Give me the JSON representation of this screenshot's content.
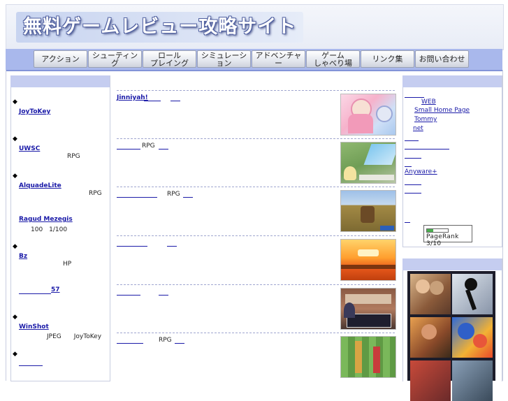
{
  "header": {
    "title": "無料ゲームレビュー攻略サイト"
  },
  "nav": {
    "items": [
      {
        "label": "アクション"
      },
      {
        "label": "シューティング"
      },
      {
        "label": "ロール\nプレイング"
      },
      {
        "label": "シミュレーション"
      },
      {
        "label": "アドベンチャー"
      },
      {
        "label": "ゲーム\nしゃべり場"
      },
      {
        "label": "リンク集"
      },
      {
        "label": "お問い合わせ"
      }
    ]
  },
  "left": {
    "items": [
      {
        "link": "JoyToKey",
        "desc": ""
      },
      {
        "link": "UWSC",
        "desc": "RPG"
      },
      {
        "link": "AlquadeLite",
        "desc": "RPG"
      },
      {
        "link": "Ragud Mezegis",
        "desc": "100　1/100"
      },
      {
        "link": "Bz",
        "desc": "HP"
      },
      {
        "link": "57",
        "desc": ""
      },
      {
        "link": "WinShot",
        "desc": "JPEG　　JoyToKey"
      },
      {
        "link": "",
        "desc": ""
      }
    ]
  },
  "main": {
    "rows": [
      {
        "title": "Jinniyah!",
        "desc": ""
      },
      {
        "title": "",
        "desc": "RPG"
      },
      {
        "title": "",
        "desc": "RPG"
      },
      {
        "title": "",
        "desc": ""
      },
      {
        "title": "",
        "desc": ""
      },
      {
        "title": "",
        "desc": "RPG"
      }
    ]
  },
  "right": {
    "links": [
      "",
      "WEB",
      "Small Home Page",
      "Tommy",
      "net",
      "",
      "",
      "",
      "",
      "Anyware+",
      "",
      "",
      ""
    ],
    "pagerank": {
      "label": "PageRank 3/10",
      "value": 3,
      "max": 10
    }
  },
  "colors": {
    "navbar": "#a9b8ec",
    "link": "#1a1aa8",
    "panel_head": "#c5cdf0"
  }
}
